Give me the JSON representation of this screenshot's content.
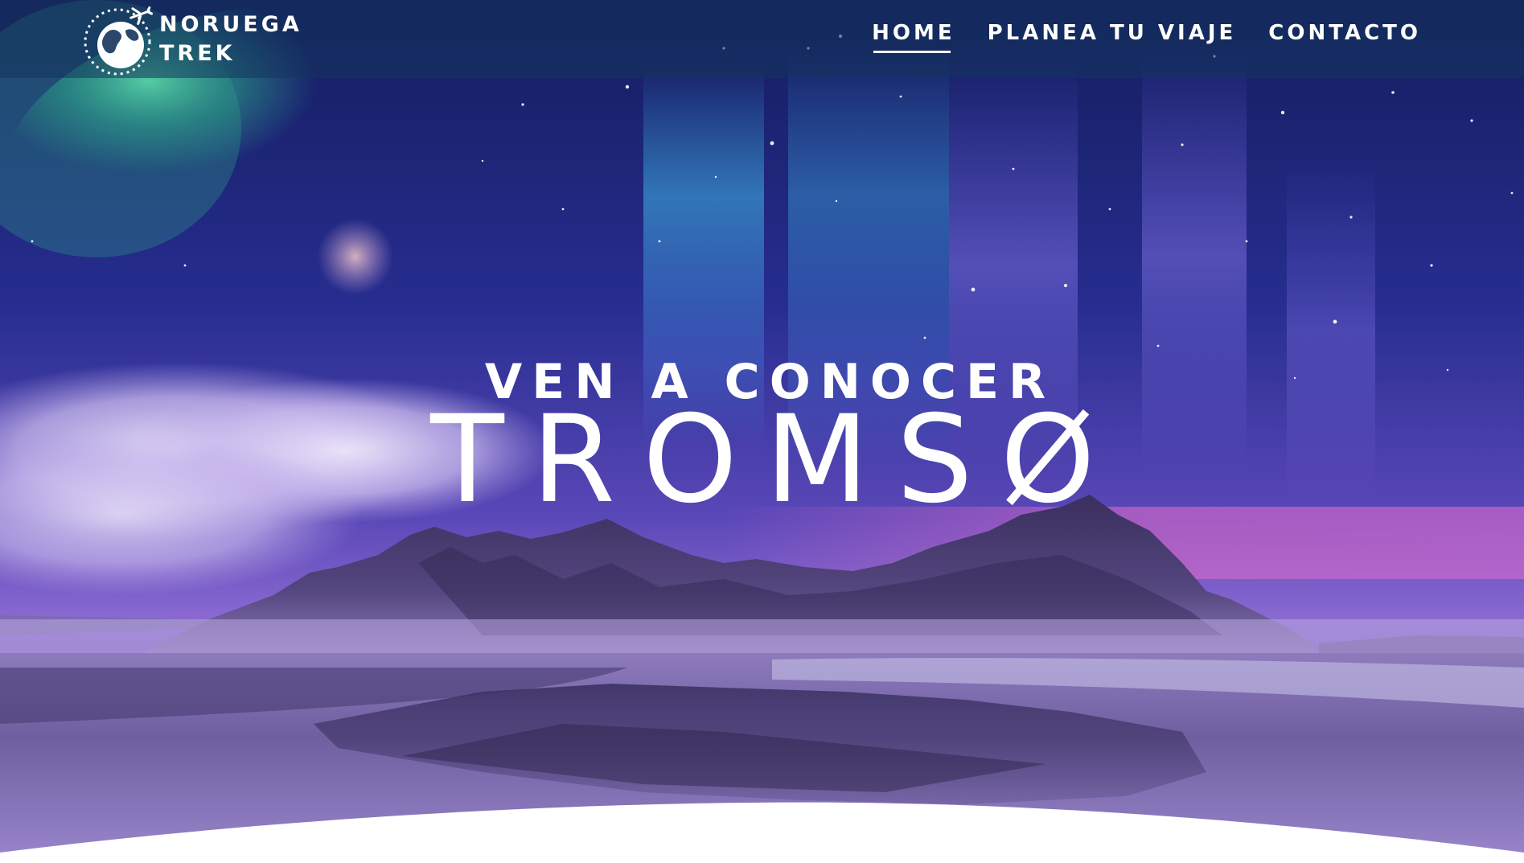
{
  "brand": {
    "line1": "NORUEGA",
    "line2": "TREK"
  },
  "nav": {
    "items": [
      {
        "label": "HOME",
        "active": true
      },
      {
        "label": "PLANEA TU VIAJE",
        "active": false
      },
      {
        "label": "CONTACTO",
        "active": false
      }
    ]
  },
  "hero": {
    "subtitle": "VEN A CONOCER",
    "title": "TROMSØ"
  },
  "colors": {
    "header_bg": "#14345c",
    "text": "#ffffff",
    "sky_top": "#1c2a7a",
    "aurora_green": "#3fd6a0",
    "aurora_blue": "#3fb6e6",
    "sky_purple": "#7a4fc8",
    "pink_glow": "#e46cc8",
    "bottom_curve": "#ffffff"
  }
}
